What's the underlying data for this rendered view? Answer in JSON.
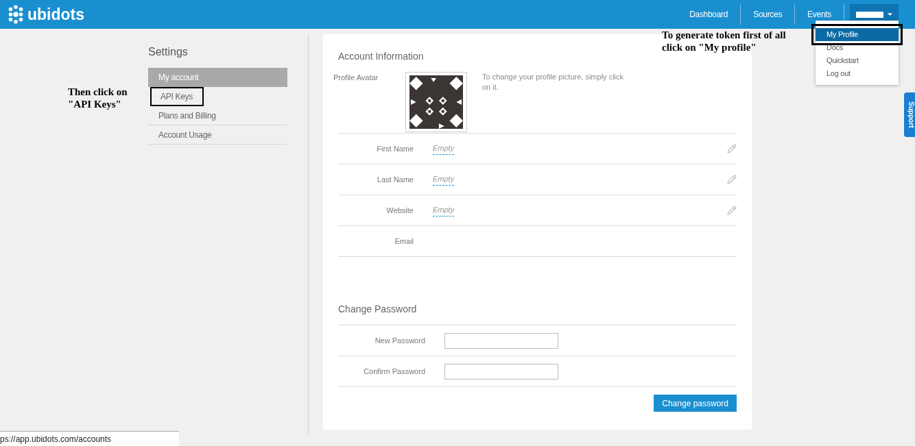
{
  "header": {
    "logo": "ubidots",
    "nav": [
      {
        "label": "Dashboard"
      },
      {
        "label": "Sources"
      },
      {
        "label": "Events"
      }
    ],
    "user_menu": {
      "expanded": true,
      "items": [
        {
          "label": "My Profile",
          "selected": true,
          "highlighted": true
        },
        {
          "label": "Docs",
          "selected": false,
          "highlighted": false
        },
        {
          "label": "Quickstart",
          "selected": false,
          "highlighted": false
        },
        {
          "label": "Log out",
          "selected": false,
          "highlighted": false
        }
      ]
    }
  },
  "sidebar": {
    "title": "Settings",
    "items": [
      {
        "label": "My account",
        "selected": true,
        "highlighted": false
      },
      {
        "label": "API Keys",
        "selected": false,
        "highlighted": true
      },
      {
        "label": "Plans and Billing",
        "selected": false,
        "highlighted": false
      },
      {
        "label": "Account Usage",
        "selected": false,
        "highlighted": false
      }
    ]
  },
  "account": {
    "title": "Account Information",
    "avatar_label": "Profile Avatar",
    "avatar_hint": "To change your profile picture, simply click on it.",
    "fields": [
      {
        "label": "First Name",
        "value": "Empty",
        "editable": true
      },
      {
        "label": "Last Name",
        "value": "Empty",
        "editable": true
      },
      {
        "label": "Website",
        "value": "Empty",
        "editable": true
      },
      {
        "label": "Email",
        "editable": false
      }
    ]
  },
  "password": {
    "title": "Change Password",
    "fields": [
      {
        "label": "New Password"
      },
      {
        "label": "Confirm Password"
      }
    ],
    "button": "Change password"
  },
  "annotations": [
    {
      "text": "Then click on \"API Keys\""
    },
    {
      "text": "To generate token first of all click on \"My profile\""
    }
  ],
  "support_tab": "Support",
  "status_bar": "ps://app.ubidots.com/accounts"
}
